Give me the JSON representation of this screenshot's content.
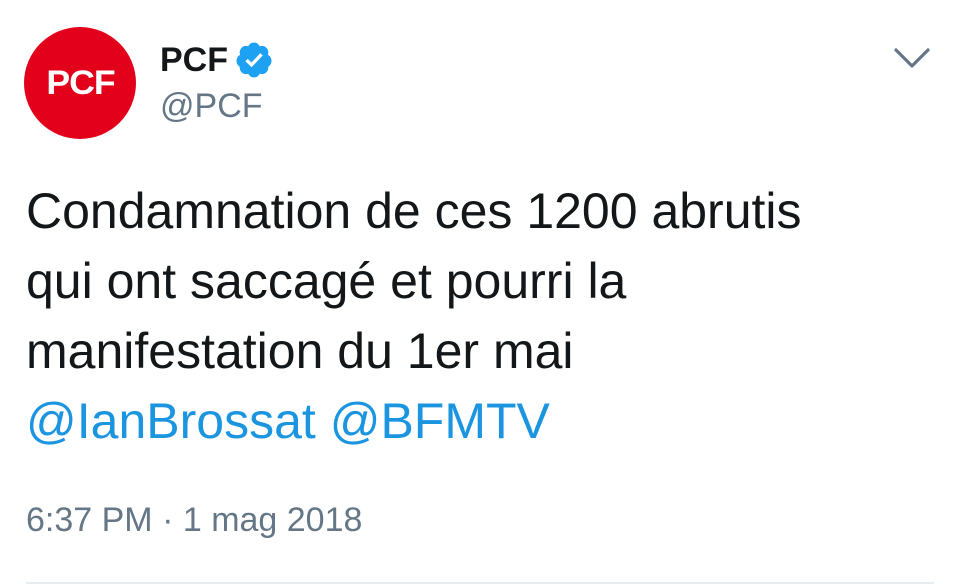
{
  "author": {
    "avatar_text": "PCF",
    "display_name": "PCF",
    "handle": "@PCF",
    "verified": true
  },
  "tweet": {
    "text_lines": [
      "Condamnation de ces 1200 abrutis",
      "qui ont saccagé et pourri la",
      "manifestation du 1er mai"
    ],
    "mentions": [
      "@IanBrossat",
      "@BFMTV"
    ],
    "timestamp": "6:37 PM · 1 mag 2018"
  },
  "icons": {
    "verified": "verified-badge-icon",
    "menu": "chevron-down-icon"
  },
  "colors": {
    "avatar_bg": "#e2001a",
    "verified": "#1da1f2",
    "mention": "#1b95e0",
    "secondary_text": "#657786",
    "primary_text": "#14171a"
  }
}
